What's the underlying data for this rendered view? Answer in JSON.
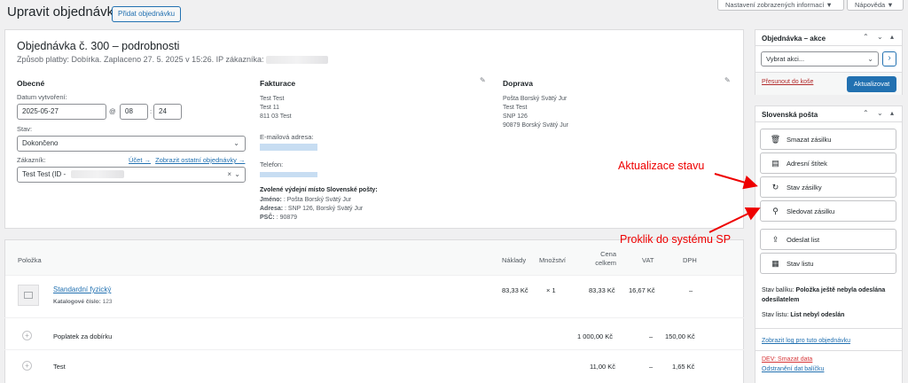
{
  "top_buttons": {
    "screen_options": "Nastavení zobrazených informací ▼",
    "help": "Nápověda ▼"
  },
  "page": {
    "title": "Upravit objednávku",
    "add_order": "Přidat objednávku"
  },
  "order": {
    "heading": "Objednávka č. 300 – podrobnosti",
    "subheading": "Způsob platby: Dobírka. Zaplaceno 27. 5. 2025 v 15:26. IP zákazníka:"
  },
  "general": {
    "title": "Obecné",
    "created_label": "Datum vytvoření:",
    "date": "2025-05-27",
    "at": "@",
    "hour": "08",
    "minute": "24",
    "status_label": "Stav:",
    "status": "Dokončeno",
    "customer_label": "Zákazník:",
    "profile_link": "Účet →",
    "other_orders_link": "Zobrazit ostatní objednávky →",
    "customer": "Test Test (ID -",
    "clear": "×"
  },
  "billing": {
    "title": "Fakturace",
    "lines": [
      "Test Test",
      "Test 11",
      "811 03 Test"
    ],
    "email_label": "E-mailová adresa:",
    "phone_label": "Telefon:",
    "pickup_title": "Zvolené výdejní místo Slovenské pošty:",
    "pickup_name_label": "Jméno:",
    "pickup_name": ": Pošta Borský Svätý Jur",
    "pickup_address_label": "Adresa:",
    "pickup_address": ": SNP 126, Borský Svätý Jur",
    "pickup_zip_label": "PSČ:",
    "pickup_zip": ": 90879"
  },
  "shipping": {
    "title": "Doprava",
    "lines": [
      "Pošta Borský Svätý Jur",
      "Test Test",
      "SNP 126",
      "90879 Borský Svätý Jur"
    ]
  },
  "items": {
    "headers": {
      "item": "Položka",
      "cost": "Náklady",
      "qty": "Množství",
      "total1": "Cena",
      "total2": "celkem",
      "vat": "VAT",
      "dph": "DPH"
    },
    "product": {
      "name": "Standardní fyzický",
      "sku_label": "Katalogové číslo:",
      "sku": "123",
      "cost": "83,33 Kč",
      "qty": "× 1",
      "total": "83,33 Kč",
      "vat": "16,67 Kč",
      "dph": "–"
    },
    "fees": [
      {
        "name": "Poplatek za dobírku",
        "total": "1 000,00 Kč",
        "vat": "–",
        "dph": "150,00 Kč"
      },
      {
        "name": "Test",
        "total": "11,00 Kč",
        "vat": "–",
        "dph": "1,65 Kč"
      }
    ]
  },
  "actions_box": {
    "title": "Objednávka – akce",
    "select": "Vybrat akci...",
    "go": "›",
    "trash": "Přesunout do koše",
    "update": "Aktualizovat"
  },
  "sp_box": {
    "title": "Slovenská pošta",
    "buttons": [
      "Smazat zásilku",
      "Adresní štítek",
      "Stav zásilky",
      "Sledovat zásilku",
      "Odeslat list",
      "Stav listu"
    ],
    "package_status_label": "Stav balíku:",
    "package_status": "Položka ještě nebyla odeslána odesílatelem",
    "sheet_status_label": "Stav listu:",
    "sheet_status": "List nebyl odeslán",
    "log_link": "Zobrazit log pro tuto objednávku",
    "dev_delete": "DEV: Smazat data",
    "remove_data": "Odstranění dat balíčku"
  },
  "annotations": {
    "status_update": "Aktualizace stavu",
    "sp_link": "Proklik do systému SP"
  },
  "colors": {
    "accent": "#2271b1",
    "annotation": "#e00000"
  }
}
